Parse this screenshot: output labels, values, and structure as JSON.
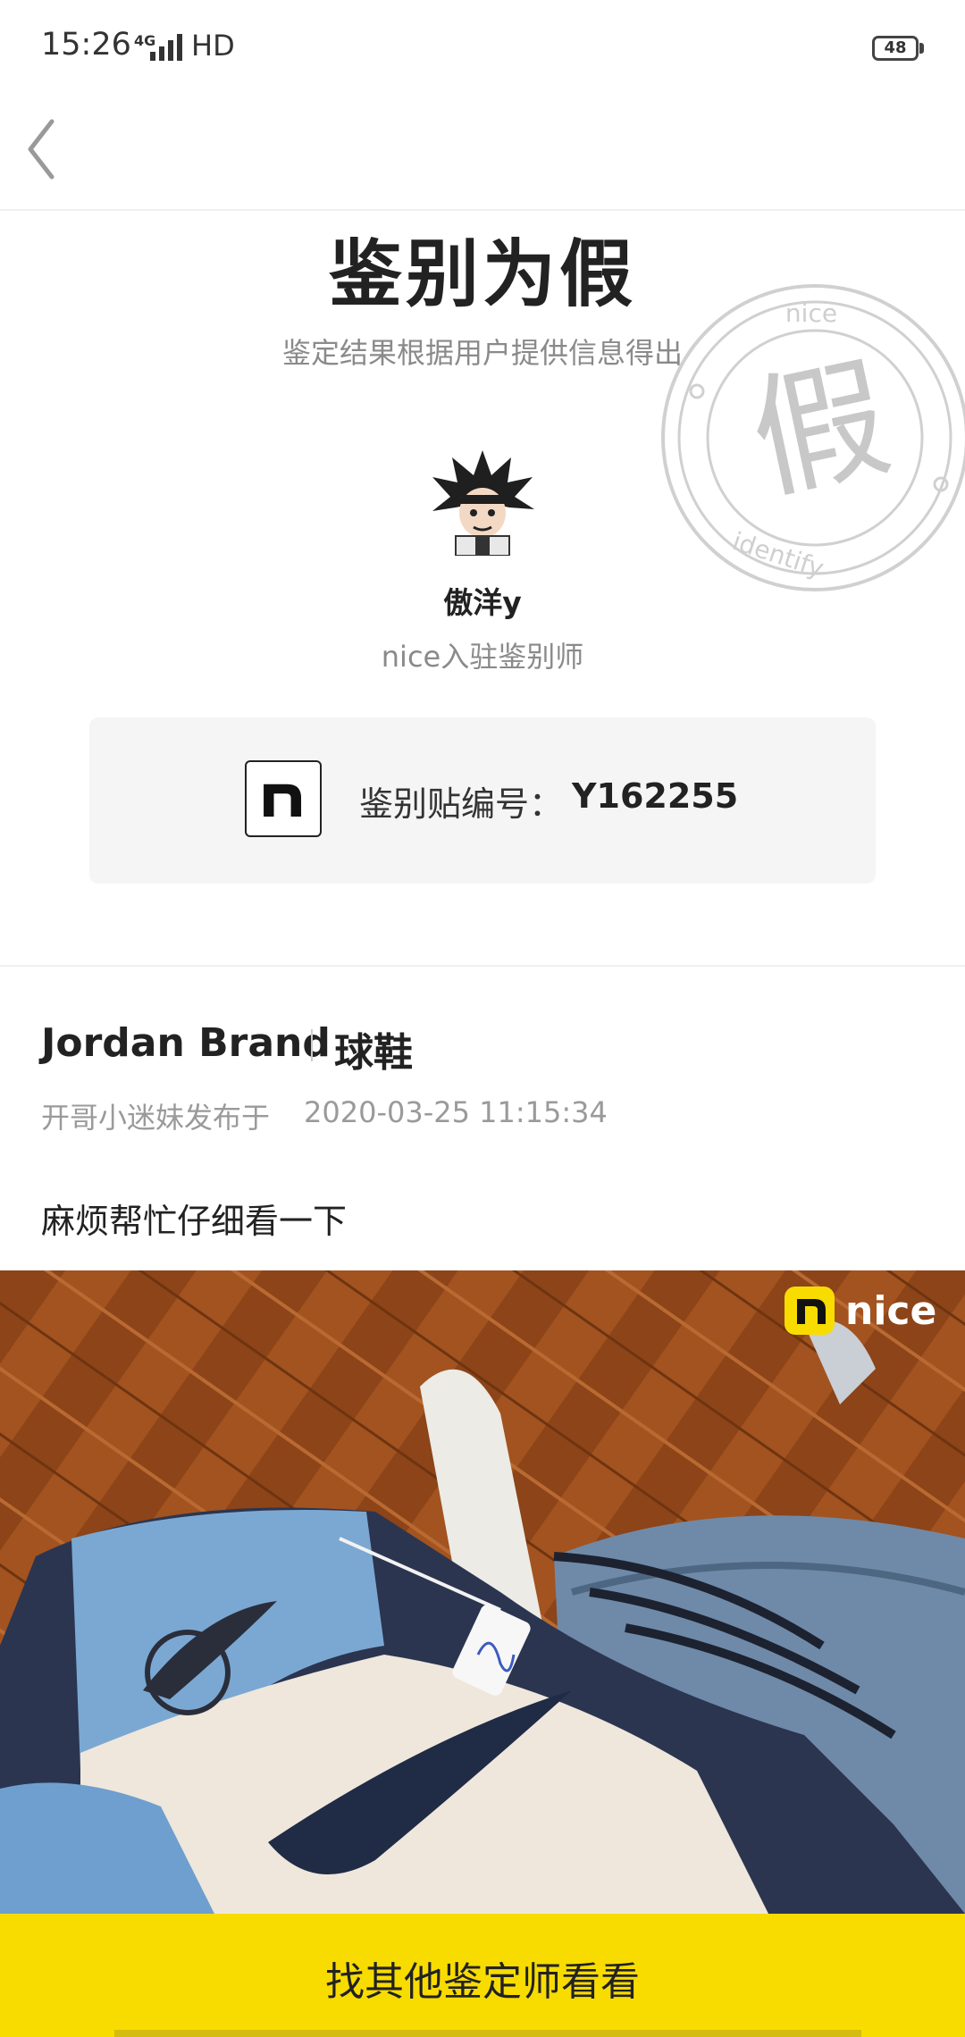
{
  "status_bar": {
    "time": "15:26",
    "network": "4G",
    "hd": "HD",
    "battery": "48"
  },
  "result": {
    "title": "鉴别为假",
    "subtitle": "鉴定结果根据用户提供信息得出",
    "stamp_char": "假",
    "stamp_top_text": "nice",
    "stamp_bottom_text": "identify"
  },
  "expert": {
    "name": "傲洋y",
    "role": "nice入驻鉴别师"
  },
  "identify_code": {
    "label": "鉴别贴编号：",
    "value": "Y162255"
  },
  "post": {
    "brand": "Jordan Brand",
    "category": "球鞋",
    "author_line": "开哥小迷妹发布于",
    "timestamp": "2020-03-25 11:15:34",
    "text": "麻烦帮忙仔细看一下",
    "photo_watermark": "nice"
  },
  "actions": {
    "bottom_button": "找其他鉴定师看看"
  },
  "colors": {
    "accent": "#f8dc00",
    "muted": "#8a8a8a"
  }
}
